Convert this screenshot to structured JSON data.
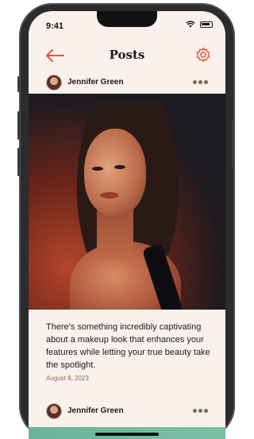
{
  "status_bar": {
    "time": "9:41",
    "icons": [
      "wifi-icon",
      "battery-icon"
    ]
  },
  "nav": {
    "title": "Posts",
    "back_icon": "arrow-left-icon",
    "settings_icon": "gear-icon"
  },
  "posts": [
    {
      "author": "Jennifer Green",
      "caption": "There's something incredibly captivating about a makeup look that enhances your features while letting your true beauty take the spotlight.",
      "date": "August 8, 2023"
    },
    {
      "author": "Jennifer Green"
    }
  ],
  "colors": {
    "accent": "#e5533d",
    "background": "#fbf1ec",
    "date_text": "#8a6a55"
  }
}
